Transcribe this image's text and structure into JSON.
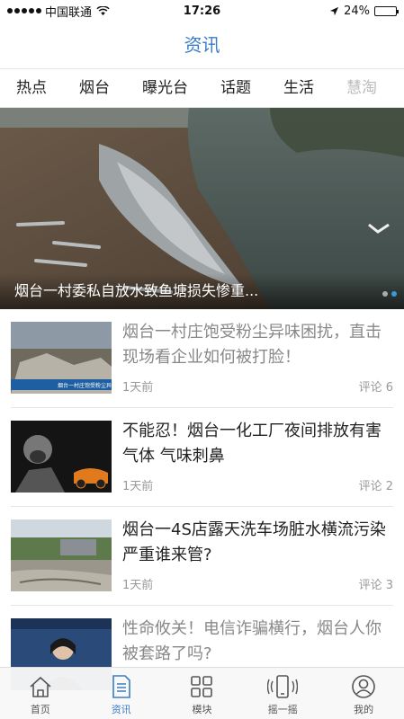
{
  "status_bar": {
    "carrier": "中国联通",
    "time": "17:26",
    "battery": "24%",
    "battery_level": 0.24
  },
  "page_title": "资讯",
  "tabs": [
    {
      "label": "热点"
    },
    {
      "label": "烟台"
    },
    {
      "label": "曝光台"
    },
    {
      "label": "话题"
    },
    {
      "label": "生活"
    },
    {
      "label": "慧淘"
    }
  ],
  "active_tab_index": 2,
  "hero": {
    "caption": "烟台一村委私自放水致鱼塘损失惨重...",
    "page_count": 2,
    "current_page": 2
  },
  "articles": [
    {
      "title": "烟台一村庄饱受粉尘异味困扰，直击现场看企业如何被打脸！",
      "time": "1天前",
      "comments": "评论 6",
      "read": true,
      "thumb_caption": "烟台一村庄饱受粉尘异味困扰"
    },
    {
      "title": "不能忍！烟台一化工厂夜间排放有害气体 气味刺鼻",
      "time": "1天前",
      "comments": "评论 2",
      "read": false
    },
    {
      "title": "烟台一4S店露天洗车场脏水横流污染严重谁来管?",
      "time": "1天前",
      "comments": "评论 3",
      "read": false
    },
    {
      "title": "性命攸关！电信诈骗横行，烟台人你被套路了吗?",
      "time": "",
      "comments": "",
      "read": true
    }
  ],
  "bottom_nav": [
    {
      "label": "首页",
      "icon": "home-icon"
    },
    {
      "label": "资讯",
      "icon": "document-icon"
    },
    {
      "label": "模块",
      "icon": "grid-icon"
    },
    {
      "label": "摇一摇",
      "icon": "phone-shake-icon"
    },
    {
      "label": "我的",
      "icon": "user-icon"
    }
  ],
  "active_nav_index": 1,
  "colors": {
    "accent": "#3a7cc5",
    "pager_active": "#3a9ad9"
  }
}
